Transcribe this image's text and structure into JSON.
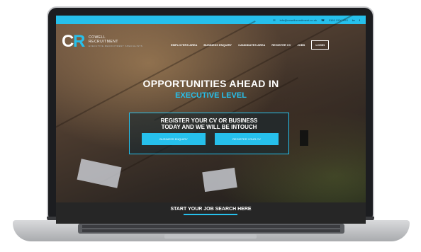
{
  "topbar": {
    "email": "info@cowellrecruitment.co.uk",
    "phone": "0161 XXX XXX",
    "social": [
      "in",
      "f"
    ]
  },
  "logo": {
    "initials_c": "C",
    "initials_r": "R",
    "name_line1": "COWELL",
    "name_line2": "RECRUITMENT",
    "tagline": "EXECUTIVE RECRUITMENT SPECIALISTS"
  },
  "nav": {
    "items": [
      "EMPLOYERS AREA",
      "BUSINESS ENQUIRY",
      "CANDIDATES AREA",
      "REGISTER CV",
      "JOBS"
    ],
    "login": "LOGIN"
  },
  "hero": {
    "title": "OPPORTUNITIES AHEAD IN",
    "subtitle": "EXECUTIVE LEVEL"
  },
  "cta": {
    "line1": "REGISTER YOUR CV OR BUSINESS",
    "line2": "TODAY AND WE WILL BE INTOUCH",
    "business_button": "BUSINESS ENQUIRY",
    "cv_button": "REGISTER YOUR CV"
  },
  "search": {
    "title": "START YOUR JOB SEARCH HERE"
  },
  "colors": {
    "accent": "#26c0ec",
    "dark_band": "#262626"
  },
  "icons": [
    "envelope-icon",
    "phone-icon",
    "linkedin-icon",
    "facebook-icon"
  ]
}
